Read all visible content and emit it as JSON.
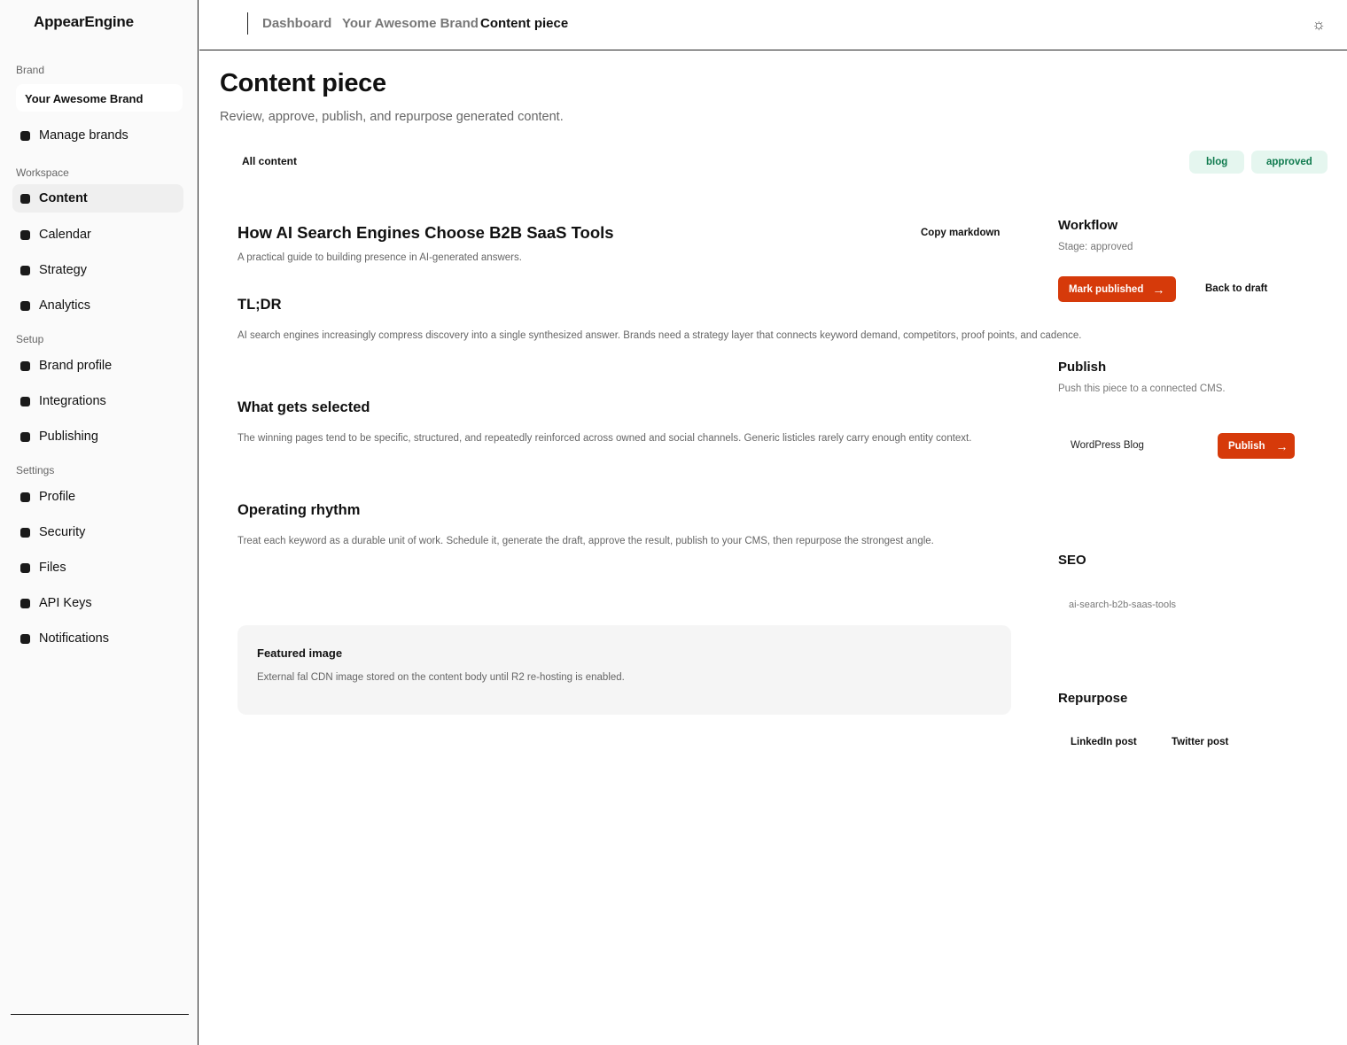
{
  "app": {
    "name": "AppearEngine"
  },
  "sidebar": {
    "brand_label": "Brand",
    "brand_selected": "Your Awesome Brand",
    "manage_brands": "Manage brands",
    "workspace_label": "Workspace",
    "workspace_items": [
      {
        "label": "Content",
        "active": true
      },
      {
        "label": "Calendar"
      },
      {
        "label": "Strategy"
      },
      {
        "label": "Analytics"
      }
    ],
    "setup_label": "Setup",
    "setup_items": [
      {
        "label": "Brand profile"
      },
      {
        "label": "Integrations"
      },
      {
        "label": "Publishing"
      }
    ],
    "settings_label": "Settings",
    "settings_items": [
      {
        "label": "Profile"
      },
      {
        "label": "Security"
      },
      {
        "label": "Files"
      },
      {
        "label": "API Keys"
      },
      {
        "label": "Notifications"
      }
    ]
  },
  "header": {
    "breadcrumb": [
      "Dashboard",
      "Your Awesome Brand",
      "Content piece"
    ],
    "theme_icon": "☼"
  },
  "page": {
    "title": "Content piece",
    "subtitle": "Review, approve, publish, and repurpose generated content.",
    "back_link": "All content",
    "badges": [
      "blog",
      "approved"
    ]
  },
  "article": {
    "title": "How AI Search Engines Choose B2B SaaS Tools",
    "copy_markdown": "Copy markdown",
    "subtitle": "A practical guide to building presence in AI-generated answers.",
    "sections": [
      {
        "heading": "TL;DR",
        "body": "AI search engines increasingly compress discovery into a single synthesized answer. Brands need a strategy layer that connects keyword demand, competitors, proof points, and cadence."
      },
      {
        "heading": "What gets selected",
        "body": "The winning pages tend to be specific, structured, and repeatedly reinforced across owned and social channels. Generic listicles rarely carry enough entity context."
      },
      {
        "heading": "Operating rhythm",
        "body": "Treat each keyword as a durable unit of work. Schedule it, generate the draft, approve the result, publish to your CMS, then repurpose the strongest angle."
      }
    ],
    "featured": {
      "title": "Featured image",
      "text": "External fal CDN image stored on the content body until R2 re-hosting is enabled."
    }
  },
  "panel": {
    "workflow": {
      "heading": "Workflow",
      "stage": "Stage: approved",
      "mark_published": "Mark published",
      "back_to_draft": "Back to draft"
    },
    "publish": {
      "heading": "Publish",
      "text": "Push this piece to a connected CMS.",
      "cms_name": "WordPress Blog",
      "publish_button": "Publish"
    },
    "seo": {
      "heading": "SEO",
      "slug": "ai-search-b2b-saas-tools"
    },
    "repurpose": {
      "heading": "Repurpose",
      "options": [
        "LinkedIn post",
        "Twitter post"
      ]
    },
    "arrow_glyph": "→"
  },
  "colors": {
    "accent": "#d63a0a",
    "badge_bg": "#e5f6ef",
    "badge_text": "#0f7a4e",
    "sidebar_bg": "#fafafa"
  }
}
